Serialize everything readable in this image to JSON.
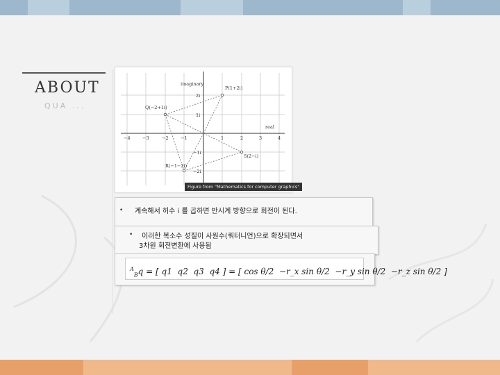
{
  "colors": {
    "top_bar": "#9db8cc",
    "bottom_bar": "#e8a06a"
  },
  "section": {
    "title": "ABOUT",
    "subtitle": "QUA ..."
  },
  "figure": {
    "axis_x_label": "real",
    "axis_y_label": "imaginary",
    "x_ticks": [
      "−4",
      "−3",
      "−2",
      "−1",
      "1",
      "2",
      "3",
      "4"
    ],
    "y_ticks": [
      "2i",
      "1i",
      "−1i",
      "−2i"
    ],
    "points": [
      {
        "label": "P(1+2i)",
        "x": 1,
        "y": 2
      },
      {
        "label": "Q(−2+1i)",
        "x": -2,
        "y": 1
      },
      {
        "label": "R(−1−2i)",
        "x": -1,
        "y": -2
      },
      {
        "label": "S(2−i)",
        "x": 2,
        "y": -1
      }
    ],
    "caption": "Figure from \"Mathematics for computer graphics\""
  },
  "bullets": [
    {
      "text": "계속해서 허수 i 를 곱하면 반시계 방향으로 회전이 된다."
    },
    {
      "line1": "이러한 복소수 성질이 사원수(쿼터니언)으로 확장되면서",
      "line2": "3차원 회전변환에 사용됨"
    }
  ],
  "formula": {
    "lhs": "q",
    "lhs_pre_super": "A",
    "lhs_pre_sub": "B",
    "vector": [
      "q1",
      "q2",
      "q3",
      "q4"
    ],
    "terms": [
      "cos θ/2",
      "−r_x sin θ/2",
      "−r_y sin θ/2",
      "−r_z sin θ/2"
    ]
  }
}
